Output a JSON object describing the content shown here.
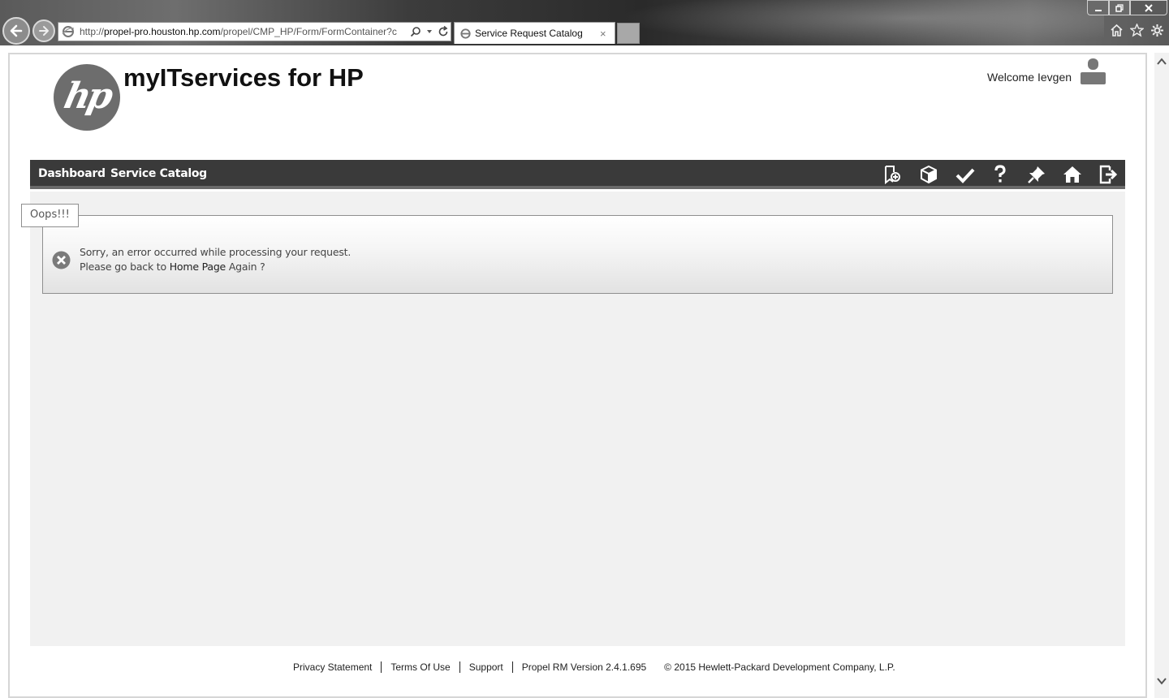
{
  "browser": {
    "url_prefix": "http://",
    "url_host": "propel-pro.houston.hp.com",
    "url_path": "/propel/CMP_HP/Form/FormContainer?c",
    "tab_title": "Service Request Catalog",
    "tab_close": "×"
  },
  "header": {
    "logo_text": "hp",
    "site_title": "myITservices for HP",
    "welcome": "Welcome Ievgen"
  },
  "navbar": {
    "links": [
      "Dashboard",
      "Service Catalog"
    ],
    "icons": [
      "new-request-icon",
      "catalog-box-icon",
      "approvals-check-icon",
      "help-icon",
      "pin-icon",
      "home-icon",
      "logout-icon"
    ]
  },
  "error": {
    "legend": "Oops!!!",
    "line1": "Sorry, an error occurred while processing your request.",
    "line2_prefix": "Please go back to ",
    "home_link": "Home Page",
    "line2_suffix": " Again ?"
  },
  "footer": {
    "links": [
      "Privacy Statement",
      "Terms Of Use",
      "Support",
      "Propel RM Version 2.4.1.695"
    ],
    "copyright": "© 2015 Hewlett-Packard Development Company, L.P."
  },
  "colors": {
    "navbar": "#3a3a3a",
    "content_bg": "#f1f1f1",
    "logo": "#6d6d6d"
  }
}
